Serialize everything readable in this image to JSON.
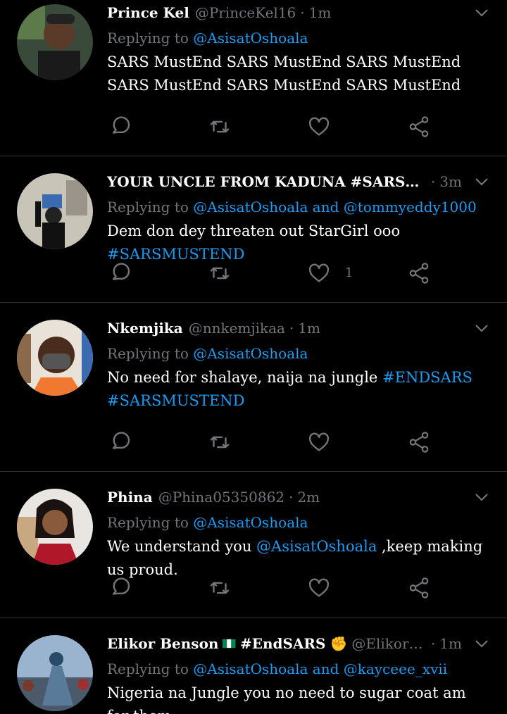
{
  "colors": {
    "background": "#000000",
    "secondary_text": "#71767b",
    "link": "#1d9bf0",
    "divider": "#2f3336"
  },
  "icons": [
    "reply-icon",
    "retweet-icon",
    "like-icon",
    "share-icon",
    "chevron-down-icon"
  ],
  "tweets": [
    {
      "name": "Prince Kel",
      "handle": "@PrinceKel16",
      "time": "1m",
      "replying_prefix": "Replying to",
      "mentions": [
        "@AsisatOshoala"
      ],
      "text": "SARS MustEnd SARS MustEnd SARS MustEnd SARS MustEnd SARS MustEnd SARS MustEnd"
    },
    {
      "name": "YOUR UNCLE FROM KADUNA #SARSMUSTEND ...",
      "handle": "",
      "time": "3m",
      "replying_prefix": "Replying to",
      "mentions": [
        "@AsisatOshoala",
        "and",
        "@tommyeddy1000"
      ],
      "text_plain": "Dem don dey threaten out StarGirl ooo ",
      "text_tag": "#SARSMUSTEND",
      "like_count": "1"
    },
    {
      "name": "Nkemjika",
      "handle": "@nnkemjikaa",
      "time": "1m",
      "replying_prefix": "Replying to",
      "mentions": [
        "@AsisatOshoala"
      ],
      "text_plain": "No need for shalaye, naija na jungle ",
      "text_tag1": "#ENDSARS",
      "text_tag2": "#SARSMUSTEND"
    },
    {
      "name": "Phina",
      "handle": "@Phina05350862",
      "time": "2m",
      "replying_prefix": "Replying to",
      "mentions": [
        "@AsisatOshoala"
      ],
      "text_plain1": "We understand you ",
      "text_mention": "@AsisatOshoala",
      "text_plain2": " ,keep making us proud."
    },
    {
      "name": "Elikor Benson",
      "name_tag": "#EndSARS",
      "handle": "@ElikorBens...",
      "time": "1m",
      "replying_prefix": "Replying to",
      "mentions": [
        "@AsisatOshoala",
        "and",
        "@kayceee_xvii"
      ],
      "text": "Nigeria na Jungle you no need to sugar coat am for them"
    }
  ]
}
